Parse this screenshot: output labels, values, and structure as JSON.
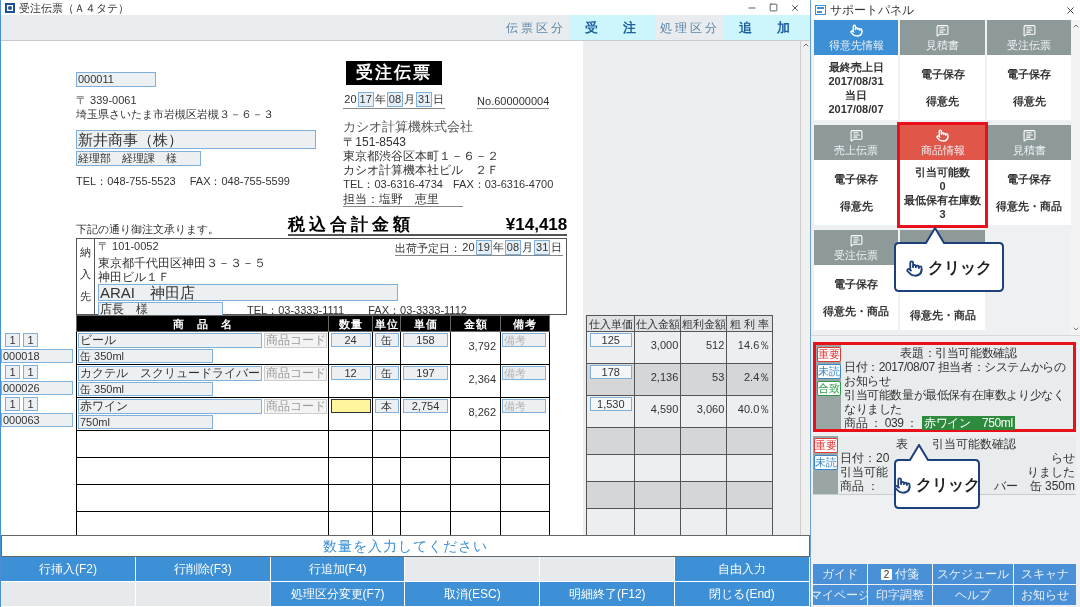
{
  "window": {
    "title": "受注伝票（Ａ４タテ）"
  },
  "header": {
    "fields": [
      {
        "label": "伝票区分",
        "value": "受　注"
      },
      {
        "label": "処理区分",
        "value": "追　加"
      }
    ]
  },
  "slip": {
    "customer_code": "000011",
    "postal": "〒 339-0061",
    "address": "埼玉県さいたま市岩槻区岩槻３－６－３",
    "company": "新井商事（株）",
    "department": "経理部　経理課　様",
    "tel": "TEL：048-755-5523",
    "fax": "FAX：048-755-5599",
    "title": "受注伝票",
    "date": [
      {
        "text": "20",
        "boxed": false
      },
      {
        "text": "17",
        "boxed": true
      },
      {
        "text": "年",
        "boxed": false
      },
      {
        "text": "08",
        "boxed": true
      },
      {
        "text": "月",
        "boxed": false
      },
      {
        "text": "31",
        "boxed": true
      },
      {
        "text": "日",
        "boxed": false
      }
    ],
    "number": "No.600000004",
    "issuer": {
      "name": "カシオ計算機株式会社",
      "lines": [
        "〒151-8543",
        "東京都渋谷区本町１－６－２",
        "カシオ計算機本社ビル　２Ｆ"
      ],
      "tel": "TEL：03-6316-4734",
      "fax": "FAX：03-6316-4700",
      "staff": "担当：塩野　恵里"
    },
    "note": "下記の通り御注文承ります。",
    "total_label": "税込合計金額",
    "total": "¥14,418",
    "delivery": {
      "side_label": "納入先",
      "postal": "〒 101-0052",
      "address_lines": [
        "東京都千代田区神田３－３－５",
        "神田ビル１Ｆ"
      ],
      "name": "ARAI　神田店",
      "contact": "店長　様",
      "tel": "TEL：03-3333-1111",
      "fax": "FAX：03-3333-1112",
      "ship_label": "出荷予定日：",
      "ship_date": [
        {
          "text": "20",
          "boxed": false
        },
        {
          "text": "19",
          "boxed": true
        },
        {
          "text": "年",
          "boxed": false
        },
        {
          "text": "08",
          "boxed": true
        },
        {
          "text": "月",
          "boxed": false
        },
        {
          "text": "31",
          "boxed": true
        },
        {
          "text": "日",
          "boxed": false
        }
      ]
    }
  },
  "lines": {
    "columns": [
      "商　品　名",
      "数量",
      "単位",
      "単価",
      "金額",
      "備考"
    ],
    "rows": [
      {
        "no_a": "1",
        "no_b": "1",
        "code": "000018",
        "name": "ビール",
        "code_button": "商品コード",
        "spec": "缶 350ml",
        "qty": "24",
        "unit": "缶",
        "price": "158",
        "amount": "3,792",
        "remark_placeholder": "備考",
        "focused": false
      },
      {
        "no_a": "1",
        "no_b": "1",
        "code": "000026",
        "name": "カクテル　スクリュードライバー",
        "code_button": "商品コード",
        "spec": "缶 350ml",
        "qty": "12",
        "unit": "缶",
        "price": "197",
        "amount": "2,364",
        "remark_placeholder": "備考",
        "focused": false
      },
      {
        "no_a": "1",
        "no_b": "1",
        "code": "000063",
        "name": "赤ワイン",
        "code_button": "商品コード",
        "spec": "750ml",
        "unit": "本",
        "price": "2,754",
        "amount": "8,262",
        "remark_placeholder": "備考",
        "focused": true
      }
    ]
  },
  "costs": {
    "columns": [
      "仕入単価",
      "仕入金額",
      "粗利金額",
      "粗 利 率"
    ],
    "rows": [
      {
        "unit_cost": "125",
        "cost": "3,000",
        "profit": "512",
        "rate": "14.6％"
      },
      {
        "unit_cost": "178",
        "cost": "2,136",
        "profit": "53",
        "rate": "2.4％"
      },
      {
        "unit_cost": "1,530",
        "cost": "4,590",
        "profit": "3,060",
        "rate": "40.0％"
      }
    ]
  },
  "message": "数量を入力してください",
  "function_keys": [
    [
      {
        "kind": "key",
        "label": "行挿入(F2)"
      },
      {
        "kind": "key",
        "label": "行削除(F3)"
      },
      {
        "kind": "key",
        "label": "行追加(F4)"
      },
      {
        "kind": "blank"
      },
      {
        "kind": "blank"
      },
      {
        "kind": "key",
        "label": "自由入力"
      }
    ],
    [
      {
        "kind": "blank"
      },
      {
        "kind": "blank"
      },
      {
        "kind": "key",
        "label": "処理区分変更(F7)"
      },
      {
        "kind": "key",
        "label": "取消(ESC)"
      },
      {
        "kind": "key",
        "label": "明細終了(F12)"
      },
      {
        "kind": "key",
        "label": "閉じる(End)"
      }
    ]
  ],
  "support_panel": {
    "title": "サポートパネル",
    "tiles": [
      {
        "kind": "action",
        "label": "得意先情報",
        "color": "#3d8fd6",
        "lines": [
          "最終売上日",
          "2017/08/31",
          "当日",
          "2017/08/07"
        ],
        "highlighted": false
      },
      {
        "kind": "document",
        "label": "見積書",
        "color": "#8e9a9a",
        "lines": [
          "電子保存",
          "得意先"
        ],
        "highlighted": false
      },
      {
        "kind": "document",
        "label": "受注伝票",
        "color": "#8e9a9a",
        "lines": [
          "電子保存",
          "得意先"
        ],
        "highlighted": false
      },
      {
        "kind": "document",
        "label": "売上伝票",
        "color": "#8e9a9a",
        "lines": [
          "電子保存",
          "得意先"
        ],
        "highlighted": false
      },
      {
        "kind": "action",
        "label": "商品情報",
        "color": "#e0574a",
        "lines": [
          "引当可能数",
          "0",
          "最低保有在庫数",
          "3"
        ],
        "highlighted": true
      },
      {
        "kind": "document",
        "label": "見積書",
        "color": "#8e9a9a",
        "lines": [
          "電子保存",
          "得意先・商品"
        ],
        "highlighted": false
      },
      {
        "kind": "document",
        "label": "受注伝票",
        "color": "#8e9a9a",
        "lines": [
          "電子保存",
          "得意先・商品"
        ],
        "highlighted": false
      },
      {
        "kind": "covered",
        "color": "#8e9a9a",
        "lines": [
          "得意先・商品"
        ],
        "highlighted": false
      }
    ],
    "callouts": [
      {
        "text": "クリック"
      },
      {
        "text": "クリック"
      }
    ],
    "notices": [
      {
        "kind": "full",
        "highlighted": true,
        "badges": [
          {
            "text": "重要",
            "color": "#e53935"
          },
          {
            "text": "未読",
            "color": "#3a86c8"
          },
          {
            "text": "合致",
            "color": "#2e9b4a"
          }
        ],
        "title": "表題：引当可能数確認",
        "lines": [
          "日付：2017/08/07 担当者：システムからのお知らせ",
          "引当可能数量が最低保有在庫数より少なくなりました"
        ],
        "product_prefix": "商品 ： 039 ：",
        "product": "赤ワイン　750ml"
      },
      {
        "kind": "partial",
        "highlighted": false,
        "badges": [
          {
            "text": "重要",
            "color": "#e53935"
          },
          {
            "text": "未読",
            "color": "#3a86c8"
          }
        ],
        "title_parts": [
          "表",
          "引当可能数確認"
        ],
        "line_parts": [
          [
            "日付：20",
            "らせ"
          ],
          [
            "引当可能",
            "りました"
          ],
          [
            "商品 ：",
            "バー　缶 350m"
          ]
        ]
      }
    ],
    "buttons": [
      {
        "label": "ガイド"
      },
      {
        "label": "付箋",
        "badge": "2"
      },
      {
        "label": "スケジュール"
      },
      {
        "label": "スキャナ"
      },
      {
        "label": "マイページ"
      },
      {
        "label": "印字調整"
      },
      {
        "label": "ヘルプ"
      },
      {
        "label": "お知らせ"
      }
    ]
  }
}
